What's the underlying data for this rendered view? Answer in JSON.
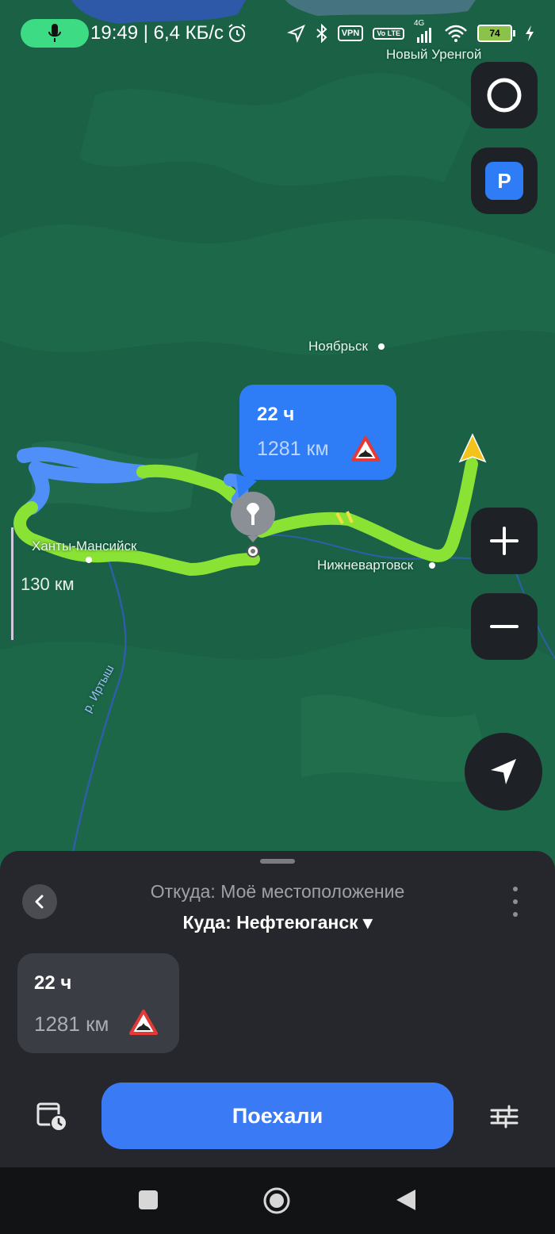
{
  "status_bar": {
    "time_and_speed": "19:49 | 6,4 КБ/с",
    "vpn": "VPN",
    "volte": "Vo LTE",
    "network": "4G",
    "battery": "74"
  },
  "map": {
    "cities": {
      "novy_urengoy": "Новый Уренгой",
      "noyabrsk": "Ноябрьск",
      "khanty_mansiysk": "Ханты-Мансийск",
      "nizhnevartovsk": "Нижневартовск"
    },
    "river_label": "р. Иртыш",
    "scale": "130 км",
    "route_callout": {
      "duration": "22 ч",
      "distance": "1281 км"
    }
  },
  "route_sheet": {
    "from": "Откуда: Моё местоположение",
    "to": "Куда: Нефтеюганск ▾",
    "route_card": {
      "duration": "22 ч",
      "distance": "1281 км"
    },
    "go_button": "Поехали"
  },
  "colors": {
    "route_green": "#8ae234",
    "route_blue": "#4f8ff7",
    "accent_blue": "#3a7bf5",
    "map_forest": "#1a6145"
  }
}
